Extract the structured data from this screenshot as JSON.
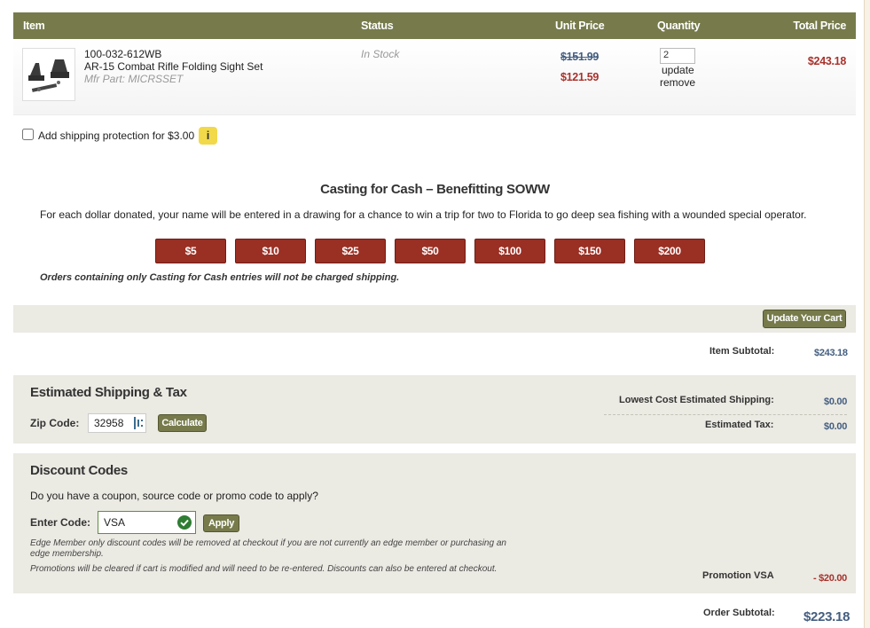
{
  "table": {
    "headers": {
      "item": "Item",
      "status": "Status",
      "unit_price": "Unit Price",
      "quantity": "Quantity",
      "total_price": "Total Price"
    }
  },
  "item": {
    "sku": "100-032-612WB",
    "name": "AR-15 Combat Rifle Folding Sight Set",
    "mfr_part": "Mfr Part: MICRSSET",
    "status": "In Stock",
    "old_price": "$151.99",
    "new_price": "$121.59",
    "quantity": "2",
    "update_label": "update",
    "remove_label": "remove",
    "total": "$243.18"
  },
  "protection": {
    "label": "Add shipping protection for $3.00",
    "info": "i"
  },
  "casting": {
    "title": "Casting for Cash – Benefitting SOWW",
    "description": "For each dollar donated, your name will be entered in a drawing for a chance to win a trip for two to Florida to go deep sea fishing with a wounded special operator.",
    "amounts": [
      "$5",
      "$10",
      "$25",
      "$50",
      "$100",
      "$150",
      "$200"
    ],
    "note": "Orders containing only Casting for Cash entries will not be charged shipping."
  },
  "cart": {
    "update_button": "Update Your Cart",
    "item_subtotal_label": "Item Subtotal:",
    "item_subtotal": "$243.18"
  },
  "shipping": {
    "title": "Estimated Shipping & Tax",
    "zip_label": "Zip Code:",
    "zip_value": "32958",
    "calculate_button": "Calculate",
    "lowest_label": "Lowest Cost Estimated Shipping:",
    "lowest_value": "$0.00",
    "tax_label": "Estimated Tax:",
    "tax_value": "$0.00"
  },
  "discount": {
    "title": "Discount Codes",
    "question": "Do you have a coupon, source code or promo code to apply?",
    "code_label": "Enter Code:",
    "code_value": "VSA",
    "apply_button": "Apply",
    "fine1": "Edge Member only discount codes will be removed at checkout if you are not currently an edge member or purchasing an edge membership.",
    "fine2": "Promotions will be cleared if cart is modified and will need to be re-entered. Discounts can also be entered at checkout.",
    "promo_label": "Promotion VSA",
    "promo_value": "- $20.00"
  },
  "order": {
    "subtotal_label": "Order Subtotal:",
    "subtotal": "$223.18"
  },
  "colors": {
    "olive": "#777b4b",
    "red": "#a8322c",
    "blue": "#445e80",
    "panel": "#ebeae3"
  },
  "icons": [
    "product-thumbnail",
    "info-icon",
    "zip-autofill-icon",
    "check-circle-icon"
  ]
}
